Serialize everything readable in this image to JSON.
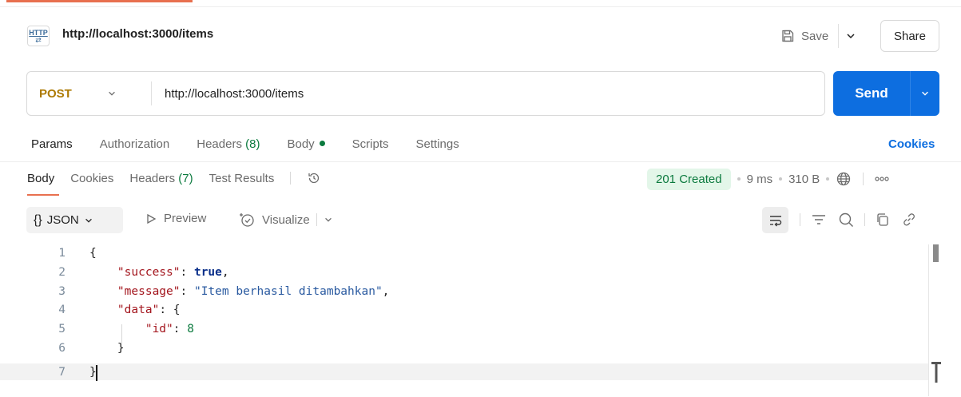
{
  "request": {
    "title": "http://localhost:3000/items",
    "badge": {
      "top": "HTTP",
      "bottom": "⇄"
    },
    "save_label": "Save",
    "share_label": "Share",
    "method": "POST",
    "url": "http://localhost:3000/items",
    "send_label": "Send",
    "tabs": [
      {
        "label": "Params",
        "count": "",
        "active": true
      },
      {
        "label": "Authorization",
        "count": ""
      },
      {
        "label": "Headers ",
        "count": "(8)"
      },
      {
        "label": "Body",
        "count": "",
        "has_dot": true
      },
      {
        "label": "Scripts",
        "count": ""
      },
      {
        "label": "Settings",
        "count": ""
      }
    ],
    "cookies_label": "Cookies"
  },
  "response": {
    "tabs": [
      {
        "label": "Body",
        "active": true
      },
      {
        "label": "Cookies"
      },
      {
        "label": "Headers ",
        "count": "(7)"
      },
      {
        "label": "Test Results"
      }
    ],
    "status": "201 Created",
    "time": "9 ms",
    "size": "310 B",
    "format_label": "JSON",
    "format_glyph": "{}",
    "preview_label": "Preview",
    "visualize_label": "Visualize",
    "code_lines": [
      {
        "no": "1",
        "text": "{"
      },
      {
        "no": "2",
        "text": "    \"success\": true,"
      },
      {
        "no": "3",
        "text": "    \"message\": \"Item berhasil ditambahkan\","
      },
      {
        "no": "4",
        "text": "    \"data\": {"
      },
      {
        "no": "5",
        "text": "        \"id\": 8"
      },
      {
        "no": "6",
        "text": "    }"
      },
      {
        "no": "7",
        "text": "}"
      }
    ]
  },
  "colors": {
    "accent": "#e8704f",
    "send": "#0d6ee0",
    "method": "#ad7a03",
    "status_green": "#0b7a3e"
  }
}
